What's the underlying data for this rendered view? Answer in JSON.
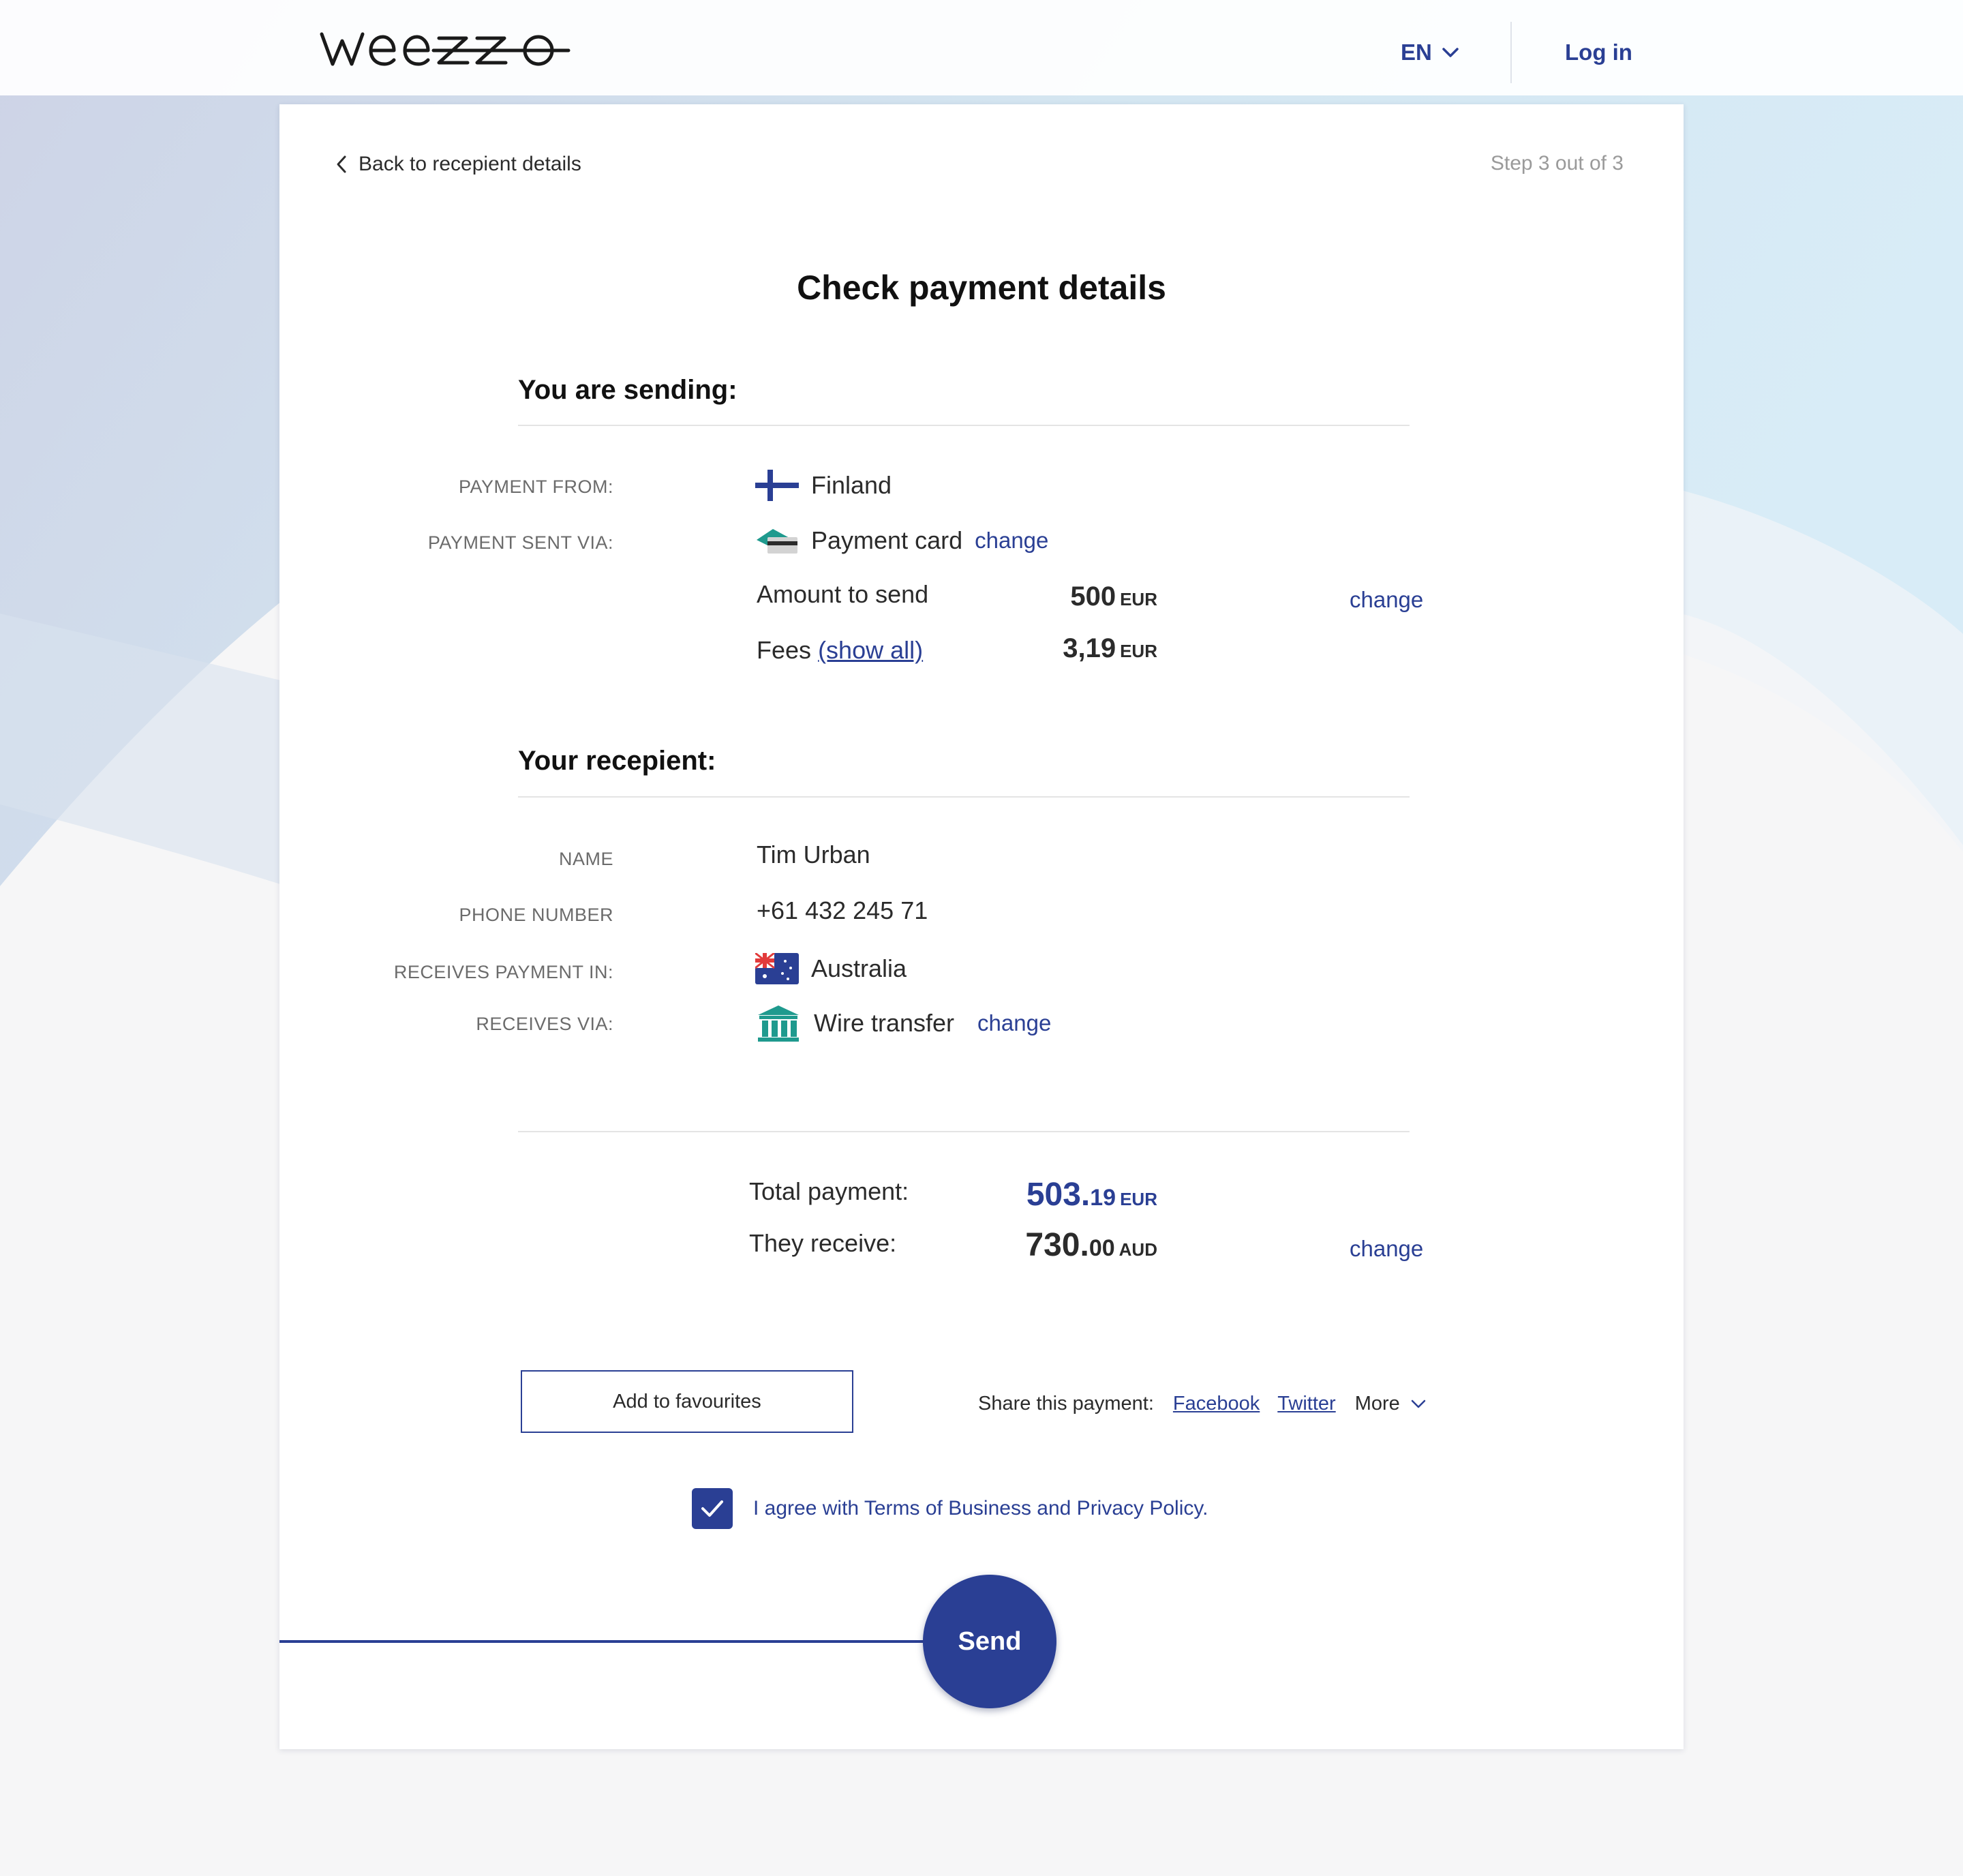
{
  "header": {
    "logo_text": "weezzo",
    "language": "EN",
    "login_label": "Log in"
  },
  "nav": {
    "back_label": "Back to recepient details",
    "step_label": "Step 3 out of 3"
  },
  "page": {
    "title": "Check payment details"
  },
  "sending": {
    "title": "You are sending:",
    "payment_from_label": "PAYMENT FROM:",
    "payment_from_value": "Finland",
    "sent_via_label": "PAYMENT SENT VIA:",
    "sent_via_value": "Payment card",
    "change_label": "change",
    "amount_label": "Amount to send",
    "amount_value": "500",
    "amount_currency": "EUR",
    "fees_label": "Fees",
    "fees_link": "(show all)",
    "fees_value": "3,19",
    "fees_currency": "EUR"
  },
  "recipient": {
    "title": "Your recepient:",
    "name_label": "NAME",
    "name_value": "Tim Urban",
    "phone_label": "PHONE NUMBER",
    "phone_value": "+61 432 245 71",
    "receives_in_label": "RECEIVES PAYMENT IN:",
    "receives_in_value": "Australia",
    "receives_via_label": "RECEIVES VIA:",
    "receives_via_value": "Wire transfer",
    "change_label": "change"
  },
  "totals": {
    "total_label": "Total payment:",
    "total_whole": "503.",
    "total_decimal": "19",
    "total_currency": "EUR",
    "receive_label": "They receive:",
    "receive_whole": "730.",
    "receive_decimal": "00",
    "receive_currency": "AUD",
    "change_label": "change"
  },
  "actions": {
    "favourites_label": "Add to favourites",
    "share_label": "Share this payment:",
    "facebook": "Facebook",
    "twitter": "Twitter",
    "more": "More",
    "agree_text": "I agree with Terms of Business and Privacy Policy.",
    "agree_checked": true,
    "send_label": "Send"
  },
  "colors": {
    "accent": "#2a3f94",
    "muted_label": "#6b6b6b",
    "step_text": "#9a9a9a",
    "teal_icon": "#1f9a8e"
  },
  "icons": {
    "language_chevron": "chevron-down-icon",
    "back": "chevron-left-icon",
    "finland_flag": "finland-flag-icon",
    "payment_card": "payment-card-icon",
    "australia_flag": "australia-flag-icon",
    "bank": "bank-icon",
    "more_chevron": "chevron-down-icon",
    "checkbox": "checkmark-icon"
  }
}
